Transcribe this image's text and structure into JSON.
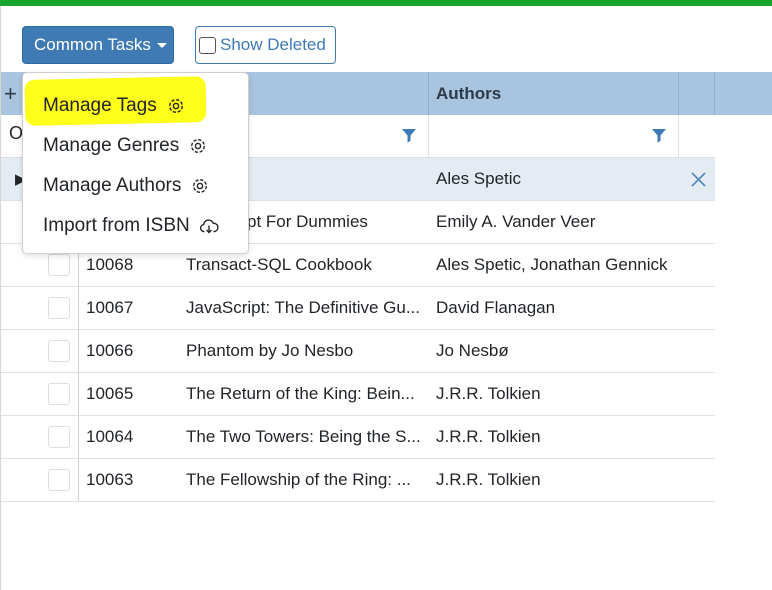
{
  "toolbar": {
    "common_tasks_label": "Common Tasks",
    "show_deleted_label": "Show Deleted"
  },
  "menu": {
    "items": [
      {
        "label": "Manage Tags",
        "icon": "gear-icon"
      },
      {
        "label": "Manage Genres",
        "icon": "gear-icon"
      },
      {
        "label": "Manage Authors",
        "icon": "gear-icon"
      },
      {
        "label": "Import from ISBN",
        "icon": "cloud-download-icon"
      }
    ]
  },
  "grid": {
    "headers": {
      "authors": "Authors"
    },
    "selected_row": {
      "title_tail": "",
      "authors": "Ales Spetic"
    },
    "partial_row": {
      "title_tail": "pt For Dummies",
      "authors": "Emily A. Vander Veer"
    },
    "rows": [
      {
        "id": "10068",
        "title": "Transact-SQL Cookbook",
        "authors": "Ales Spetic, Jonathan Gennick"
      },
      {
        "id": "10067",
        "title": "JavaScript: The Definitive Gu...",
        "authors": "David Flanagan"
      },
      {
        "id": "10066",
        "title": "Phantom by Jo Nesbo",
        "authors": "Jo Nesbø"
      },
      {
        "id": "10065",
        "title": "The Return of the King: Bein...",
        "authors": "J.R.R. Tolkien"
      },
      {
        "id": "10064",
        "title": "The Two Towers: Being the S...",
        "authors": "J.R.R. Tolkien"
      },
      {
        "id": "10063",
        "title": "The Fellowship of the Ring: ...",
        "authors": "J.R.R. Tolkien"
      }
    ]
  },
  "colors": {
    "accent": "#3f7ab4",
    "header_bg": "#a8c4de",
    "highlight": "#ffff1a",
    "top_bar": "#1aa531"
  }
}
